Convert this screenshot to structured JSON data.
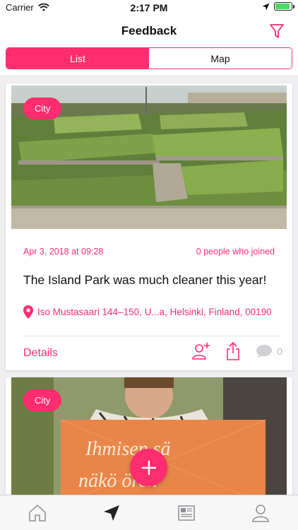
{
  "status_bar": {
    "carrier": "Carrier",
    "time": "2:17 PM",
    "battery_level": 0.9,
    "icons": [
      "wifi-icon",
      "location-arrow-icon",
      "battery-icon"
    ]
  },
  "header": {
    "title": "Feedback",
    "filter_icon": "filter-icon"
  },
  "segments": {
    "list": "List",
    "map": "Map",
    "selected": "List"
  },
  "colors": {
    "accent": "#ff2d6f",
    "inactive_icon": "#b8b8bd",
    "background": "#efeff2"
  },
  "feed": [
    {
      "category": "City",
      "date": "Apr 3, 2018 at 09:28",
      "joined": "0 people who joined",
      "title": "The Island Park was much cleaner this year!",
      "address": "Iso Mustasaari 144–150, U...a, Helsinki, Finland, 00190",
      "details_label": "Details",
      "comment_count": "0",
      "icons": [
        "location-pin-icon",
        "join-user-icon",
        "share-icon",
        "comment-icon"
      ]
    },
    {
      "category": "City"
    }
  ],
  "fab": {
    "icon": "plus-icon"
  },
  "tab_bar": [
    "home-icon",
    "navigation-arrow-icon",
    "news-icon",
    "profile-icon"
  ]
}
